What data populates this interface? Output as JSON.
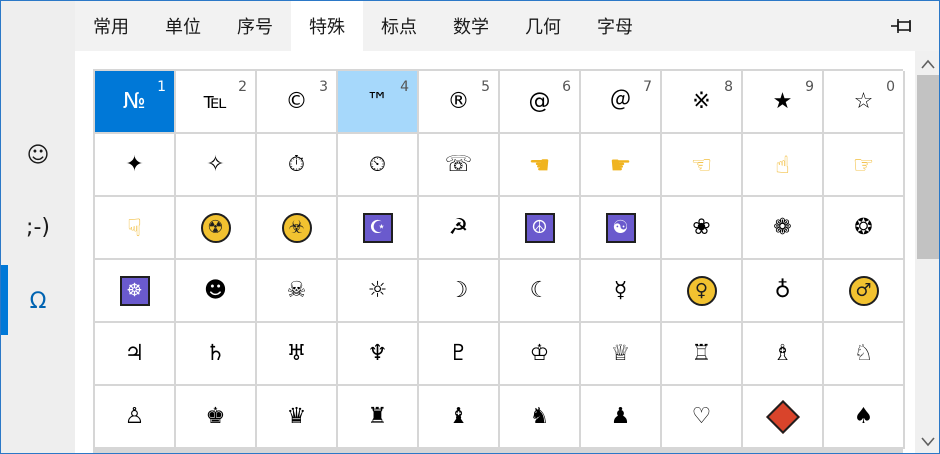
{
  "rail": {
    "items": [
      {
        "glyph": "☺",
        "name": "emoji"
      },
      {
        "glyph": ";-)",
        "name": "kaomoji"
      },
      {
        "glyph": "Ω",
        "name": "symbols"
      }
    ],
    "active_index": 2
  },
  "tabs": [
    {
      "label": "常用"
    },
    {
      "label": "单位"
    },
    {
      "label": "序号"
    },
    {
      "label": "特殊"
    },
    {
      "label": "标点"
    },
    {
      "label": "数学"
    },
    {
      "label": "几何"
    },
    {
      "label": "字母"
    }
  ],
  "active_tab": 3,
  "header": {
    "pin_icon": "pin-icon",
    "close_icon": "close-icon"
  },
  "colors": {
    "accent": "#0078d7",
    "hover": "#a6d8fb",
    "grid_line": "#d6d6d6"
  },
  "rows": [
    [
      {
        "glyph": "№",
        "num": "1",
        "state": "sel"
      },
      {
        "glyph": "℡",
        "num": "2"
      },
      {
        "glyph": "©",
        "num": "3"
      },
      {
        "glyph": "™",
        "num": "4",
        "state": "hover"
      },
      {
        "glyph": "®",
        "num": "5"
      },
      {
        "glyph": "@",
        "num": "6"
      },
      {
        "glyph": "＠",
        "num": "7"
      },
      {
        "glyph": "※",
        "num": "8"
      },
      {
        "glyph": "★",
        "num": "9"
      },
      {
        "glyph": "☆",
        "num": "0"
      }
    ],
    [
      {
        "glyph": "✦"
      },
      {
        "glyph": "✧"
      },
      {
        "glyph": "⏱"
      },
      {
        "glyph": "⏲"
      },
      {
        "glyph": "☏"
      },
      {
        "glyph": "☚",
        "kind": "hand"
      },
      {
        "glyph": "☛",
        "kind": "hand"
      },
      {
        "glyph": "☜",
        "kind": "hand"
      },
      {
        "glyph": "☝",
        "kind": "hand"
      },
      {
        "glyph": "☞",
        "kind": "hand"
      }
    ],
    [
      {
        "glyph": "☟",
        "kind": "hand"
      },
      {
        "glyph": "☢",
        "kind": "circle"
      },
      {
        "glyph": "☣",
        "kind": "circle"
      },
      {
        "glyph": "☪",
        "kind": "box"
      },
      {
        "glyph": "☭"
      },
      {
        "glyph": "☮",
        "kind": "box"
      },
      {
        "glyph": "☯",
        "kind": "box"
      },
      {
        "glyph": "❀"
      },
      {
        "glyph": "❁"
      },
      {
        "glyph": "❂"
      }
    ],
    [
      {
        "glyph": "☸",
        "kind": "box"
      },
      {
        "glyph": "☻"
      },
      {
        "glyph": "☠"
      },
      {
        "glyph": "☼"
      },
      {
        "glyph": "☽"
      },
      {
        "glyph": "☾"
      },
      {
        "glyph": "☿"
      },
      {
        "glyph": "♀",
        "kind": "circle"
      },
      {
        "glyph": "♁"
      },
      {
        "glyph": "♂",
        "kind": "circle"
      }
    ],
    [
      {
        "glyph": "♃"
      },
      {
        "glyph": "♄"
      },
      {
        "glyph": "♅"
      },
      {
        "glyph": "♆"
      },
      {
        "glyph": "♇"
      },
      {
        "glyph": "♔"
      },
      {
        "glyph": "♕"
      },
      {
        "glyph": "♖"
      },
      {
        "glyph": "♗"
      },
      {
        "glyph": "♘"
      }
    ],
    [
      {
        "glyph": "♙"
      },
      {
        "glyph": "♚"
      },
      {
        "glyph": "♛"
      },
      {
        "glyph": "♜"
      },
      {
        "glyph": "♝"
      },
      {
        "glyph": "♞"
      },
      {
        "glyph": "♟"
      },
      {
        "glyph": "♡"
      },
      {
        "glyph": "",
        "kind": "diamond"
      },
      {
        "glyph": "♠"
      }
    ]
  ],
  "scroll": {
    "up_icon": "scroll-up-icon",
    "down_icon": "scroll-down-icon"
  }
}
